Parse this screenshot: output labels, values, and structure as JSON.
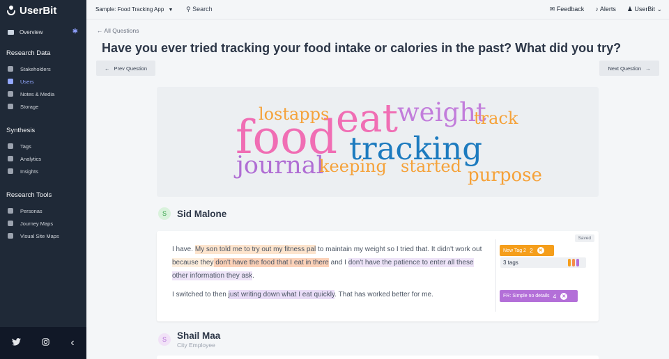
{
  "app": {
    "name": "UserBit"
  },
  "sidebar": {
    "overview": "Overview",
    "sections": [
      {
        "title": "Research Data",
        "items": [
          "Stakeholders",
          "Users",
          "Notes & Media",
          "Storage"
        ]
      },
      {
        "title": "Synthesis",
        "items": [
          "Tags",
          "Analytics",
          "Insights"
        ]
      },
      {
        "title": "Research Tools",
        "items": [
          "Personas",
          "Journey Maps",
          "Visual Site Maps"
        ]
      }
    ],
    "active_item": "Users",
    "social": {
      "twitter": "twitter-icon",
      "instagram": "instagram-icon",
      "collapse": "‹"
    }
  },
  "topbar": {
    "project": "Sample: Food Tracking App",
    "search": "Search",
    "feedback": "Feedback",
    "alerts": "Alerts",
    "user": "UserBit"
  },
  "main": {
    "back_link": "All Questions",
    "question": "Have you ever tried tracking your food intake or calories in the past? What did you try?",
    "prev_button": "Prev Question",
    "next_button": "Next Question",
    "word_cloud": [
      {
        "text": "food",
        "color": "#f06eb4"
      },
      {
        "text": "eat",
        "color": "#f06eb4"
      },
      {
        "text": "weight",
        "color": "#c27ddb"
      },
      {
        "text": "track",
        "color": "#f5a23a"
      },
      {
        "text": "tracking",
        "color": "#1d7bbf"
      },
      {
        "text": "lost",
        "color": "#f5a23a"
      },
      {
        "text": "apps",
        "color": "#f5a23a"
      },
      {
        "text": "journal",
        "color": "#b06ed4"
      },
      {
        "text": "keeping",
        "color": "#f5a23a"
      },
      {
        "text": "started",
        "color": "#f5a23a"
      },
      {
        "text": "purpose",
        "color": "#f5a23a"
      }
    ],
    "responses": [
      {
        "initial": "S",
        "name": "Sid Malone",
        "role": "",
        "status": "Saved",
        "p1": {
          "t1": "I have. ",
          "h1": "My son told me to try out my fitness pal",
          "t2": " to maintain my weight so I tried that. It didn't work out",
          "h2": " because they",
          "h3": " don't have the food that I eat in there",
          "t3": " and I ",
          "h4": "don't have the patience to enter all these other information they ask",
          "t4": "."
        },
        "p2": {
          "t1": "I switched to then ",
          "h1": "just writing down what I eat quickly",
          "t2": ". That has worked better for me."
        },
        "tags": {
          "tag1_label": "New Tag 2",
          "tag1_count": "2",
          "tags_summary": "3 tags",
          "tag2_label": "FR: Simple no details",
          "tag2_count": "4"
        }
      },
      {
        "initial": "S",
        "name": "Shail Maa",
        "role": "City Employee"
      }
    ]
  },
  "colors": {
    "sidebar_bg": "#1f2937",
    "accent": "#93a8ff",
    "tag_orange": "#f59e1b",
    "tag_purple": "#b36fd8"
  }
}
